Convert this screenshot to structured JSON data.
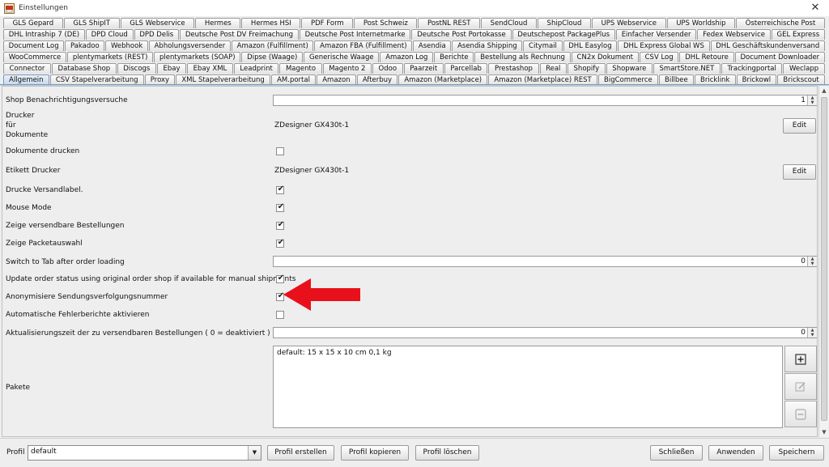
{
  "window": {
    "title": "Einstellungen",
    "close_glyph": "✕"
  },
  "tabs": {
    "row1": [
      "GLS Gepard",
      "GLS ShipIT",
      "GLS Webservice",
      "Hermes",
      "Hermes HSI",
      "PDF Form",
      "Post Schweiz",
      "PostNL REST",
      "SendCloud",
      "ShipCloud",
      "UPS Webservice",
      "UPS Worldship",
      "Österreichische Post"
    ],
    "row2": [
      "DHL Intraship 7 (DE)",
      "DPD Cloud",
      "DPD Delis",
      "Deutsche Post DV Freimachung",
      "Deutsche Post Internetmarke",
      "Deutsche Post Portokasse",
      "Deutschepost PackagePlus",
      "Einfacher Versender",
      "Fedex Webservice",
      "GEL Express"
    ],
    "row3": [
      "Document Log",
      "Pakadoo",
      "Webhook",
      "Abholungsversender",
      "Amazon (Fulfillment)",
      "Amazon FBA (Fulfillment)",
      "Asendia",
      "Asendia Shipping",
      "Citymail",
      "DHL Easylog",
      "DHL Express Global WS",
      "DHL Geschäftskundenversand"
    ],
    "row4": [
      "WooCommerce",
      "plentymarkets (REST)",
      "plentymarkets (SOAP)",
      "Dipse (Waage)",
      "Generische Waage",
      "Amazon Log",
      "Berichte",
      "Bestellung als Rechnung",
      "CN2x Dokument",
      "CSV Log",
      "DHL Retoure",
      "Document Downloader"
    ],
    "row5": [
      "Connector",
      "Database Shop",
      "Discogs",
      "Ebay",
      "Ebay XML",
      "Leadprint",
      "Magento",
      "Magento 2",
      "Odoo",
      "Paarzeit",
      "Parcellab",
      "Prestashop",
      "Real",
      "Shopify",
      "Shopware",
      "SmartStore.NET",
      "Trackingportal",
      "Weclapp"
    ],
    "row6": [
      "Allgemein",
      "CSV Stapelverarbeitung",
      "Proxy",
      "XML Stapelverarbeitung",
      "AM.portal",
      "Amazon",
      "Afterbuy",
      "Amazon (Marketplace)",
      "Amazon (Marketplace) REST",
      "BigCommerce",
      "Billbee",
      "Bricklink",
      "Brickowl",
      "Brickscout"
    ],
    "selected": "Allgemein"
  },
  "settings": {
    "shop_notify": {
      "label": "Shop Benachrichtigungsversuche",
      "value": "1"
    },
    "printer_docs": {
      "label_l1": "Drucker",
      "label_l2": "für",
      "label_l3": "Dokumente",
      "value": "ZDesigner GX430t-1",
      "button": "Edit"
    },
    "print_docs": {
      "label": "Dokumente drucken",
      "checked": false
    },
    "label_printer": {
      "label": "Etikett Drucker",
      "value": "ZDesigner GX430t-1",
      "button": "Edit"
    },
    "print_shiplabel": {
      "label": "Drucke Versandlabel.",
      "checked": true
    },
    "mouse_mode": {
      "label": "Mouse Mode",
      "checked": true
    },
    "show_shippable": {
      "label": "Zeige versendbare Bestellungen",
      "checked": true
    },
    "show_package_select": {
      "label": "Zeige Packetauswahl",
      "checked": true
    },
    "switch_tab": {
      "label": "Switch to Tab after order loading",
      "value": "0"
    },
    "update_status": {
      "label": "Update order status using original order shop if available for manual shipments",
      "checked": true
    },
    "anonymize": {
      "label": "Anonymisiere Sendungsverfolgungsnummer",
      "checked": true
    },
    "auto_errors": {
      "label": "Automatische Fehlerberichte aktivieren",
      "checked": false
    },
    "refresh_time": {
      "label": "Aktualisierungszeit der zu versendbaren Bestellungen ( 0 = deaktiviert )",
      "value": "0"
    },
    "packages": {
      "label": "Pakete",
      "content": "default: 15 x 15 x 10 cm 0,1 kg"
    }
  },
  "footer": {
    "profile_label": "Profil",
    "profile_value": "default",
    "create": "Profil erstellen",
    "copy": "Profil kopieren",
    "delete": "Profil löschen",
    "close": "Schließen",
    "apply": "Anwenden",
    "save": "Speichern"
  },
  "check_glyph": "✔",
  "spin_up": "▲",
  "spin_down": "▼",
  "combo_arrow": "▼",
  "colors": {
    "accent_tab": "#c7d9ec",
    "annotation_arrow": "#e8101a"
  }
}
